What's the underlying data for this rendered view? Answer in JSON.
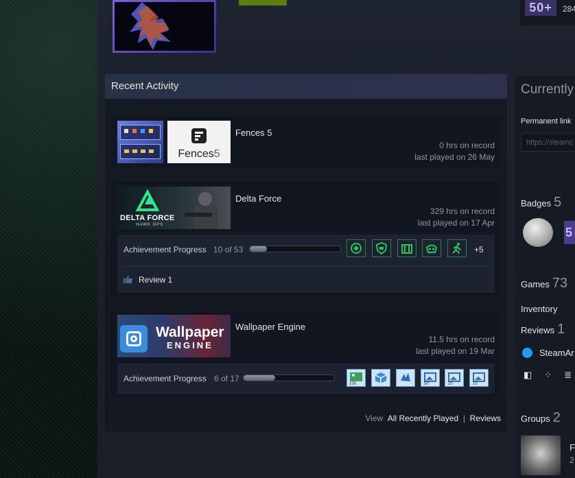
{
  "profile": {
    "level_badge": "50+",
    "top_number": "284"
  },
  "recent_activity": {
    "title": "Recent Activity",
    "games": [
      {
        "name": "Fences 5",
        "logo_text": "Fences",
        "logo_number": "5",
        "hours": "0 hrs on record",
        "last_played": "last played on 26 May"
      },
      {
        "name": "Delta Force",
        "logo_text": "DELTA FORCE",
        "logo_sub": "HAWK OPS",
        "hours": "329 hrs on record",
        "last_played": "last played on 17 Apr",
        "achievement_label": "Achievement Progress",
        "achievement_count": "10 of 53",
        "achievement_progress": 0.19,
        "achievement_more": "+5",
        "achievement_icons": [
          "ach-emblem-icon",
          "ach-shield-icon",
          "ach-crate-icon",
          "ach-mask-icon",
          "ach-runner-icon"
        ],
        "review_label": "Review 1"
      },
      {
        "name": "Wallpaper Engine",
        "logo_text": "Wallpaper",
        "logo_sub": "ENGINE",
        "hours": "11.5 hrs on record",
        "last_played": "last played on 19 Mar",
        "achievement_label": "Achievement Progress",
        "achievement_count": "6 of 17",
        "achievement_progress": 0.35,
        "achievement_icons": [
          "ach-image-100-icon",
          "ach-cube-icon",
          "ach-splash-icon",
          "ach-image-50-icon",
          "ach-image-20-icon",
          "ach-image-10-icon"
        ],
        "achievement_icon_labels": [
          "100",
          "",
          "",
          "50",
          "20",
          "10"
        ]
      }
    ],
    "view_label": "View",
    "all_recently_played": "All Recently Played",
    "separator": "|",
    "reviews_link": "Reviews"
  },
  "sidebar": {
    "currently_title": "Currently",
    "permanent_link_label": "Permanent link",
    "permanent_link_value": "https://steamc",
    "badges_label": "Badges",
    "badges_count": "5",
    "badge_50_text": "5",
    "games_label": "Games",
    "games_count": "73",
    "inventory_label": "Inventory",
    "reviews_label": "Reviews",
    "reviews_count": "1",
    "steam_item": "SteamAr",
    "groups_label": "Groups",
    "groups_count": "2",
    "group_letter": "F",
    "group_number": "2"
  },
  "colors": {
    "achievement_green": "#22c55e",
    "wallpaper_blue": "#3a8dde",
    "steam_blue": "#1a9fff"
  }
}
